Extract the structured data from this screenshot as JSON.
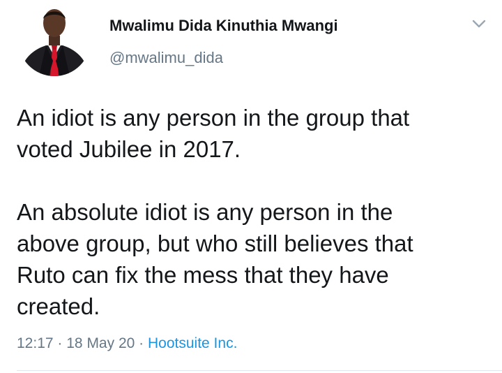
{
  "tweet": {
    "author": {
      "display_name": "Mwalimu Dida Kinuthia Mwangi",
      "handle": "@mwalimu_dida"
    },
    "body_lines": {
      "p1_line1": "An idiot is any person in the group that",
      "p1_line2": "voted Jubilee in 2017.",
      "p2_line1": "An absolute idiot is any person in the",
      "p2_line2": "above group, but who still believes that",
      "p2_line3": "Ruto can fix the mess that they have",
      "p2_line4": "created."
    },
    "meta": {
      "time": "12:17",
      "separator": "·",
      "date": "18 May 20",
      "source": "Hootsuite Inc."
    },
    "menu_icon": "chevron-down-icon"
  },
  "colors": {
    "text": "#14171a",
    "secondary": "#657786",
    "link": "#1b95e0",
    "divider": "#e1e8ed"
  }
}
